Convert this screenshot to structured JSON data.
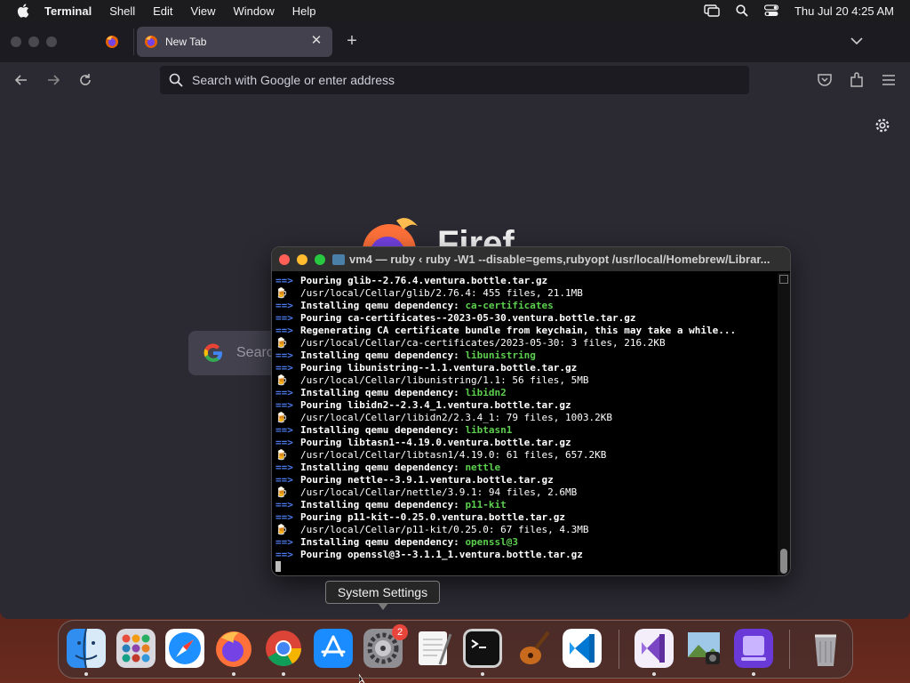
{
  "menubar": {
    "app_name": "Terminal",
    "items": [
      "Shell",
      "Edit",
      "View",
      "Window",
      "Help"
    ],
    "datetime": "Thu Jul 20  4:25 AM"
  },
  "firefox": {
    "tab_title": "New Tab",
    "tab_close": "✕",
    "new_tab": "+",
    "url_placeholder": "Search with Google or enter address",
    "wordmark": "Firef",
    "search_placeholder": "Searc"
  },
  "terminal": {
    "title": "vm4 — ruby ‹ ruby -W1 --disable=gems,rubyopt /usr/local/Homebrew/Librar...",
    "lines": [
      {
        "kind": "arrow",
        "text": "Pouring glib--2.76.4.ventura.bottle.tar.gz",
        "dep": ""
      },
      {
        "kind": "beer",
        "text": "/usr/local/Cellar/glib/2.76.4: 455 files, 21.1MB",
        "dep": ""
      },
      {
        "kind": "arrow",
        "text": "Installing qemu dependency: ",
        "dep": "ca-certificates"
      },
      {
        "kind": "arrow",
        "text": "Pouring ca-certificates--2023-05-30.ventura.bottle.tar.gz",
        "dep": ""
      },
      {
        "kind": "arrow",
        "text": "Regenerating CA certificate bundle from keychain, this may take a while...",
        "dep": ""
      },
      {
        "kind": "beer",
        "text": "/usr/local/Cellar/ca-certificates/2023-05-30: 3 files, 216.2KB",
        "dep": ""
      },
      {
        "kind": "arrow",
        "text": "Installing qemu dependency: ",
        "dep": "libunistring"
      },
      {
        "kind": "arrow",
        "text": "Pouring libunistring--1.1.ventura.bottle.tar.gz",
        "dep": ""
      },
      {
        "kind": "beer",
        "text": "/usr/local/Cellar/libunistring/1.1: 56 files, 5MB",
        "dep": ""
      },
      {
        "kind": "arrow",
        "text": "Installing qemu dependency: ",
        "dep": "libidn2"
      },
      {
        "kind": "arrow",
        "text": "Pouring libidn2--2.3.4_1.ventura.bottle.tar.gz",
        "dep": ""
      },
      {
        "kind": "beer",
        "text": "/usr/local/Cellar/libidn2/2.3.4_1: 79 files, 1003.2KB",
        "dep": ""
      },
      {
        "kind": "arrow",
        "text": "Installing qemu dependency: ",
        "dep": "libtasn1"
      },
      {
        "kind": "arrow",
        "text": "Pouring libtasn1--4.19.0.ventura.bottle.tar.gz",
        "dep": ""
      },
      {
        "kind": "beer",
        "text": "/usr/local/Cellar/libtasn1/4.19.0: 61 files, 657.2KB",
        "dep": ""
      },
      {
        "kind": "arrow",
        "text": "Installing qemu dependency: ",
        "dep": "nettle"
      },
      {
        "kind": "arrow",
        "text": "Pouring nettle--3.9.1.ventura.bottle.tar.gz",
        "dep": ""
      },
      {
        "kind": "beer",
        "text": "/usr/local/Cellar/nettle/3.9.1: 94 files, 2.6MB",
        "dep": ""
      },
      {
        "kind": "arrow",
        "text": "Installing qemu dependency: ",
        "dep": "p11-kit"
      },
      {
        "kind": "arrow",
        "text": "Pouring p11-kit--0.25.0.ventura.bottle.tar.gz",
        "dep": ""
      },
      {
        "kind": "beer",
        "text": "/usr/local/Cellar/p11-kit/0.25.0: 67 files, 4.3MB",
        "dep": ""
      },
      {
        "kind": "arrow",
        "text": "Installing qemu dependency: ",
        "dep": "openssl@3"
      },
      {
        "kind": "arrow",
        "text": "Pouring openssl@3--3.1.1_1.ventura.bottle.tar.gz",
        "dep": ""
      }
    ],
    "arrow_prefix": "==>"
  },
  "tooltip": "System Settings",
  "dock": {
    "badge_count": "2",
    "apps": [
      {
        "name": "Finder",
        "icon": "finder-icon"
      },
      {
        "name": "Launchpad",
        "icon": "launchpad-icon"
      },
      {
        "name": "Safari",
        "icon": "safari-icon"
      },
      {
        "name": "Firefox",
        "icon": "firefox-icon"
      },
      {
        "name": "Chrome",
        "icon": "chrome-icon"
      },
      {
        "name": "App Store",
        "icon": "app-store-icon"
      },
      {
        "name": "System Settings",
        "icon": "system-settings-icon"
      },
      {
        "name": "TextEdit",
        "icon": "textedit-icon"
      },
      {
        "name": "Terminal",
        "icon": "terminal-icon"
      },
      {
        "name": "Instruments",
        "icon": "instruments-icon"
      },
      {
        "name": "VS Code",
        "icon": "vscode-icon"
      },
      {
        "name": "Visual Studio",
        "icon": "visual-studio-icon"
      },
      {
        "name": "Preview",
        "icon": "preview-icon"
      },
      {
        "name": "Simulator",
        "icon": "simulator-icon"
      },
      {
        "name": "Trash",
        "icon": "trash-icon"
      }
    ]
  },
  "colors": {
    "term_arrow": "#4b7bf0",
    "term_dep": "#5ccf4e",
    "firefox_bg": "#2b2a33",
    "badge": "#e8453c"
  }
}
